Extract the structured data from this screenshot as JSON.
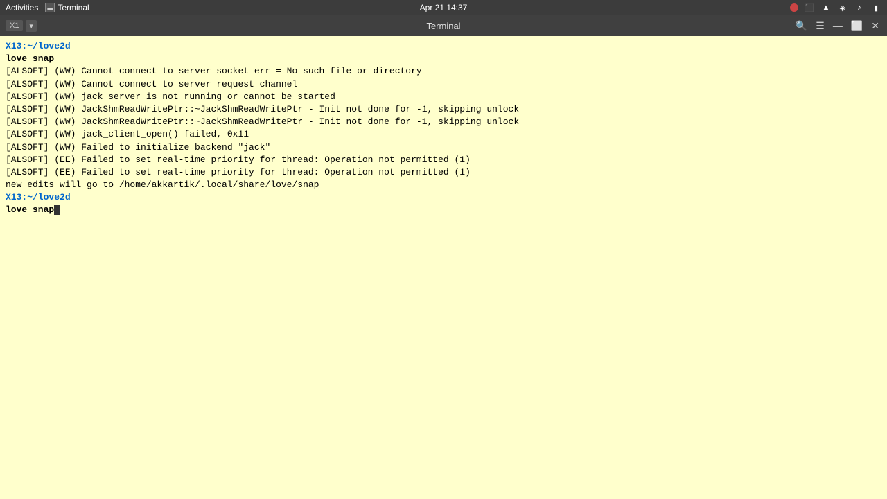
{
  "system_bar": {
    "activities": "Activities",
    "terminal_app": "Terminal",
    "datetime": "Apr 21  14:37",
    "window_title": "Terminal"
  },
  "terminal": {
    "title": "Terminal",
    "tab_label": "X1",
    "prompt1": "X13:~/love2d",
    "cmd1": "love snap",
    "output": [
      "[ALSOFT] (WW) Cannot connect to server socket err = No such file or directory",
      "[ALSOFT] (WW) Cannot connect to server request channel",
      "[ALSOFT] (WW) jack server is not running or cannot be started",
      "[ALSOFT] (WW) JackShmReadWritePtr::~JackShmReadWritePtr - Init not done for -1, skipping unlock",
      "[ALSOFT] (WW) JackShmReadWritePtr::~JackShmReadWritePtr - Init not done for -1, skipping unlock",
      "[ALSOFT] (WW) jack_client_open() failed, 0x11",
      "[ALSOFT] (WW) Failed to initialize backend \"jack\"",
      "[ALSOFT] (EE) Failed to set real-time priority for thread: Operation not permitted (1)",
      "[ALSOFT] (EE) Failed to set real-time priority for thread: Operation not permitted (1)",
      "new edits will go to /home/akkartik/.local/share/love/snap"
    ],
    "prompt2": "X13:~/love2d",
    "cmd2": "love snap"
  }
}
